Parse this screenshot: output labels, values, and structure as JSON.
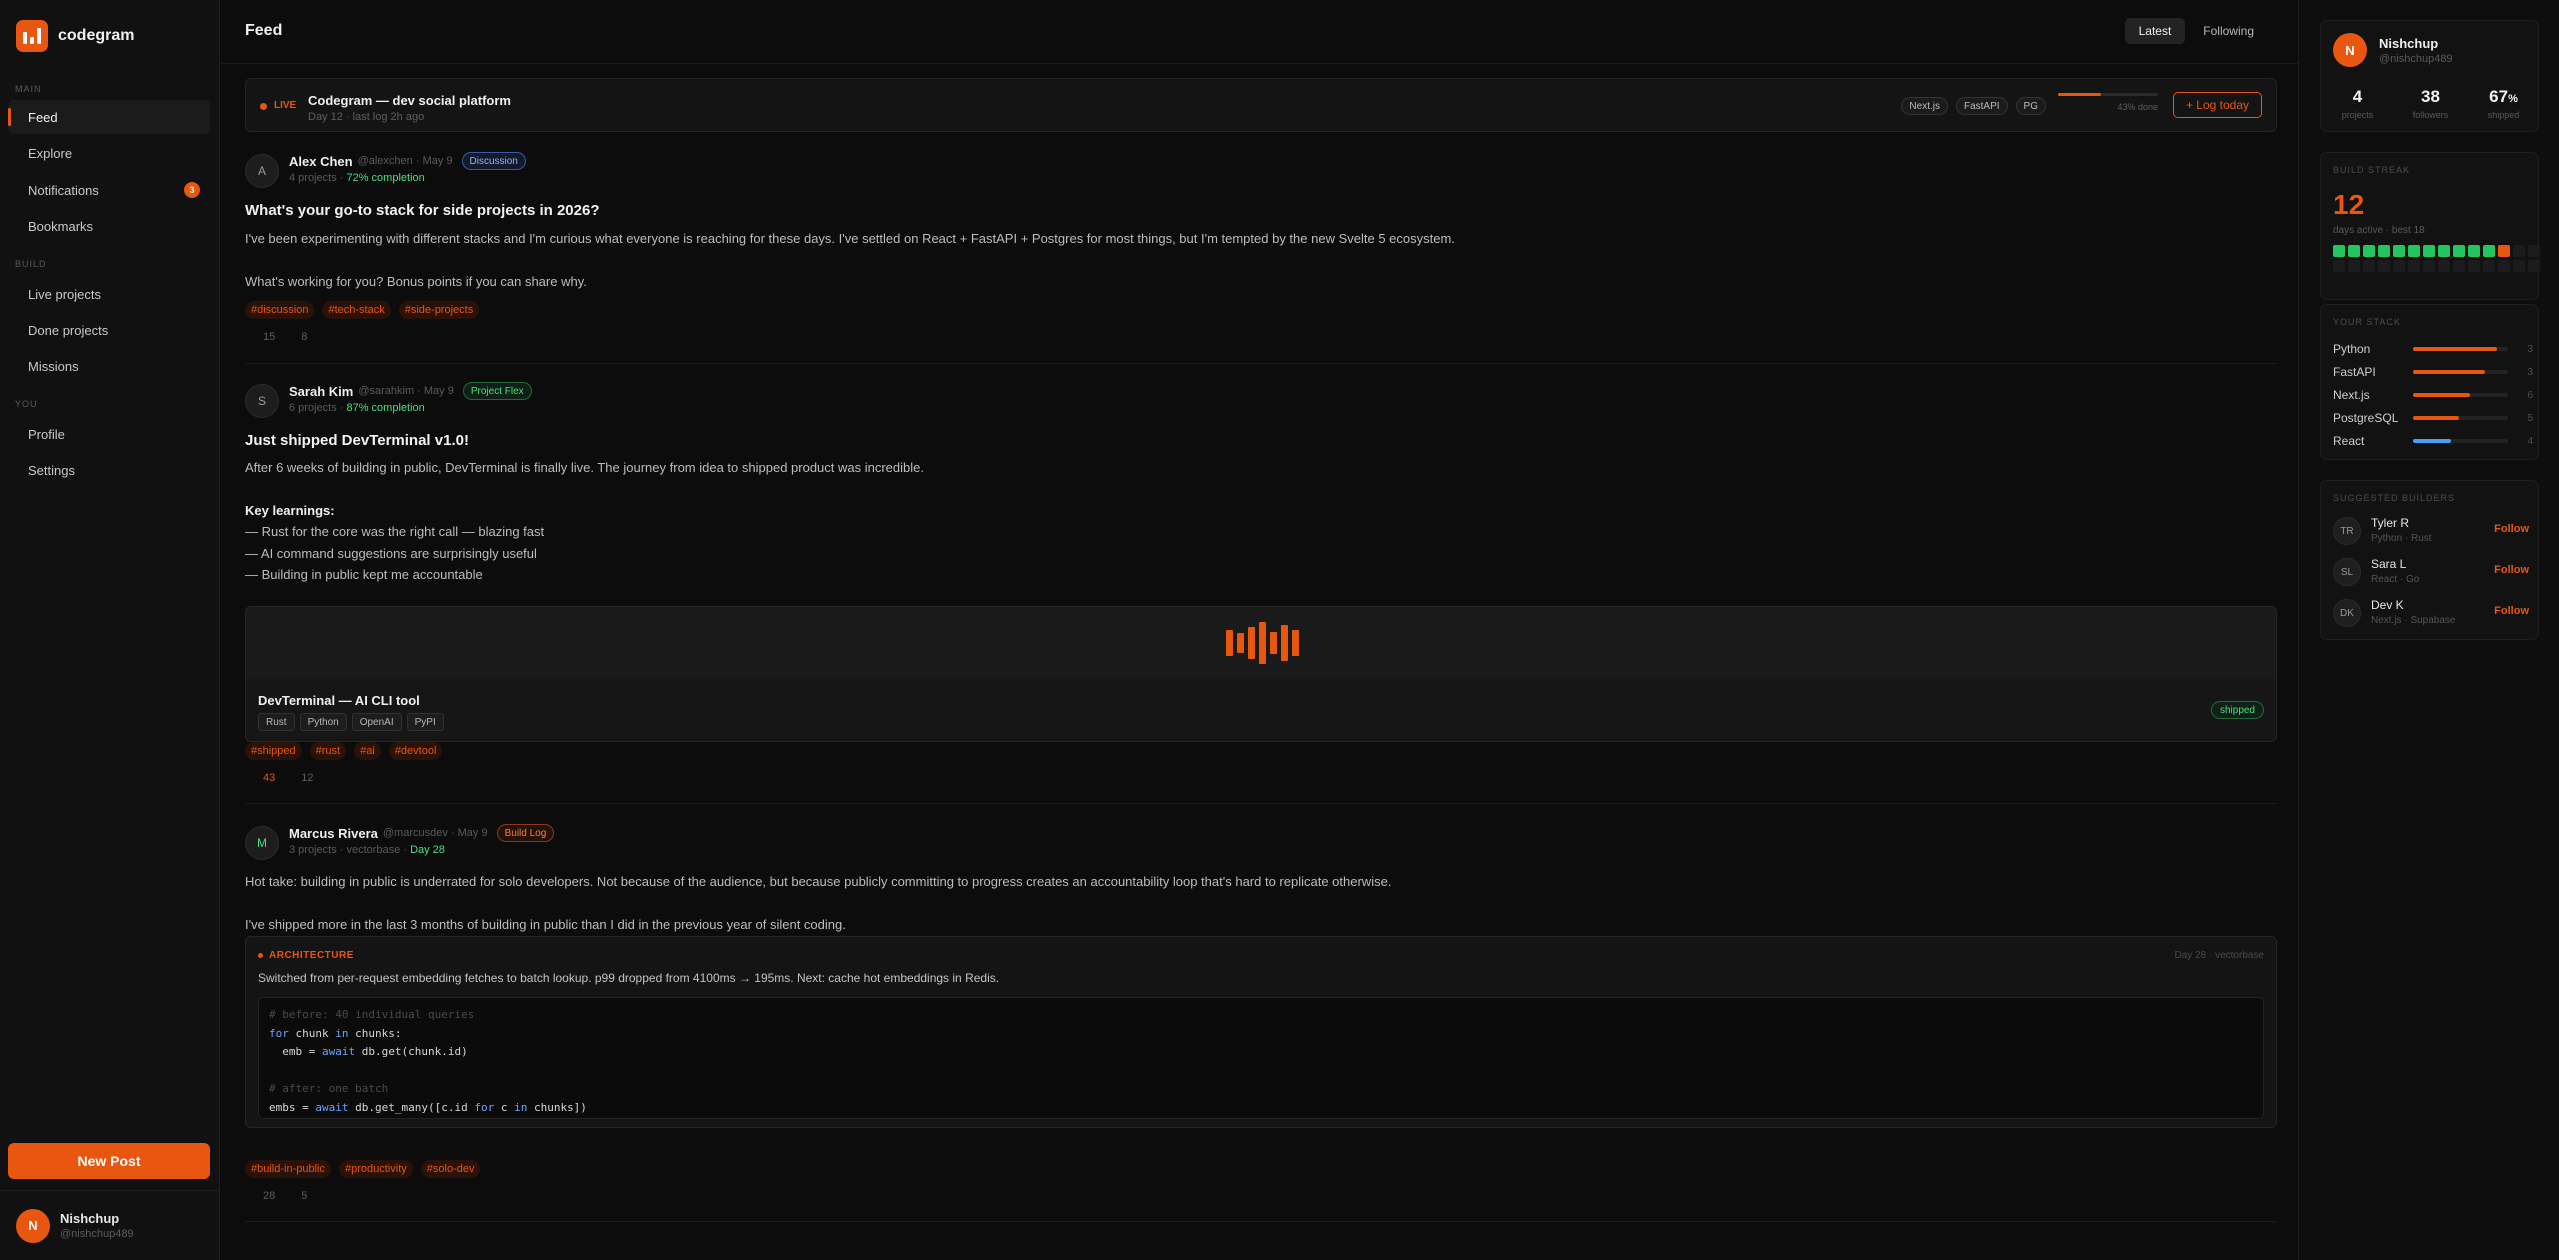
{
  "app": {
    "name": "codegram"
  },
  "sidebar": {
    "sections": {
      "main": "MAIN",
      "build": "BUILD",
      "you": "YOU"
    },
    "items": [
      {
        "label": "Feed"
      },
      {
        "label": "Explore"
      },
      {
        "label": "Notifications",
        "badge": "3"
      },
      {
        "label": "Bookmarks"
      },
      {
        "label": "Live projects"
      },
      {
        "label": "Done projects"
      },
      {
        "label": "Missions"
      },
      {
        "label": "Profile"
      },
      {
        "label": "Settings"
      }
    ],
    "new_post_label": "New Post",
    "user": {
      "initial": "N",
      "name": "Nishchup",
      "handle": "@nishchup489"
    }
  },
  "header": {
    "title": "Feed",
    "tabs": [
      {
        "label": "Latest"
      },
      {
        "label": "Following"
      }
    ]
  },
  "live_banner": {
    "label": "LIVE",
    "title": "Codegram — dev social platform",
    "subtitle": "Day 12 · last log 2h ago",
    "chips": [
      "Next.js",
      "FastAPI",
      "PG"
    ],
    "progress": 43,
    "progress_text": "43% done",
    "button_label": "+ Log today"
  },
  "posts": [
    {
      "initial": "A",
      "author": "Alex Chen",
      "meta": "@alexchen · May 9",
      "badge": "Discussion",
      "sub_prefix": "4 projects ·",
      "sub_highlight": "72% completion",
      "title": "What's your go-to stack for side projects in 2026?",
      "body": [
        "I've been experimenting with different stacks and I'm curious what everyone is reaching for these days. I've settled on React + FastAPI + Postgres for most things, but I'm tempted by the new Svelte 5 ecosystem.",
        "What's working for you? Bonus points if you can share why."
      ],
      "tags": [
        "#discussion",
        "#tech-stack",
        "#side-projects"
      ],
      "likes": "15",
      "comments": "8"
    },
    {
      "initial": "S",
      "author": "Sarah Kim",
      "meta": "@sarahkim · May 9",
      "badge": "Project Flex",
      "sub_prefix": "6 projects ·",
      "sub_highlight": "87% completion",
      "title": "Just shipped DevTerminal v1.0!",
      "body": [
        "After 6 weeks of building in public, DevTerminal is finally live. The journey from idea to shipped product was incredible.",
        "Key learnings:",
        "— Rust for the core was the right call — blazing fast",
        "— AI command suggestions are surprisingly useful",
        "— Building in public kept me accountable"
      ],
      "project": {
        "name": "DevTerminal — AI CLI tool",
        "chips": [
          "Rust",
          "Python",
          "OpenAI",
          "PyPI"
        ],
        "status": "shipped"
      },
      "tags": [
        "#shipped",
        "#rust",
        "#ai",
        "#devtool"
      ],
      "likes": "43",
      "comments": "12"
    },
    {
      "initial": "M",
      "author": "Marcus Rivera",
      "meta": "@marcusdev · May 9",
      "badge": "Build Log",
      "sub_prefix": "3 projects · vectorbase ·",
      "sub_highlight": "Day 28",
      "body": [
        "Hot take: building in public is underrated for solo developers. Not because of the audience, but because publicly committing to progress creates an accountability loop that's hard to replicate otherwise.",
        "I've shipped more in the last 3 months of building in public than I did in the previous year of silent coding."
      ],
      "architecture": {
        "label": "ARCHITECTURE",
        "day": "Day 28 · vectorbase",
        "text": "Switched from per-request embedding fetches to batch lookup. p99 dropped from 4100ms → 195ms. Next: cache hot embeddings in Redis.",
        "code": {
          "c1": "# before: 40 individual queries",
          "l2a": "for",
          "l2b": " chunk ",
          "l2c": "in",
          "l2d": " chunks:",
          "l3a": "  emb = ",
          "l3b": "await",
          "l3c": " db.get(chunk.id)",
          "c2": "# after: one batch",
          "l5a": "embs = ",
          "l5b": "await",
          "l5c": " db.get_many([c.id ",
          "l5d": "for",
          "l5e": " c ",
          "l5f": "in",
          "l5g": " chunks])"
        }
      },
      "tags": [
        "#build-in-public",
        "#productivity",
        "#solo-dev"
      ],
      "likes": "28",
      "comments": "5"
    }
  ],
  "right": {
    "profile": {
      "initial": "N",
      "name": "Nishchup",
      "handle": "@nishchup489",
      "stats": [
        {
          "value": "4",
          "label": "projects"
        },
        {
          "value": "38",
          "label": "followers"
        },
        {
          "value": "67",
          "unit": "%",
          "label": "shipped"
        }
      ]
    },
    "streak": {
      "label": "BUILD STREAK",
      "value": "12",
      "sub": "days active · best 18",
      "active_days": 12,
      "total_cells": 28
    },
    "stack": {
      "label": "YOUR STACK",
      "items": [
        {
          "name": "Python",
          "count": "3",
          "fraction": 0.88,
          "color": "#e8560f"
        },
        {
          "name": "FastAPI",
          "count": "3",
          "fraction": 0.76,
          "color": "#e8560f"
        },
        {
          "name": "Next.js",
          "count": "6",
          "fraction": 0.6,
          "color": "#e8560f"
        },
        {
          "name": "PostgreSQL",
          "count": "5",
          "fraction": 0.48,
          "color": "#e8560f"
        },
        {
          "name": "React",
          "count": "4",
          "fraction": 0.4,
          "color": "#4a9eff"
        }
      ]
    },
    "suggested": {
      "label": "SUGGESTED BUILDERS",
      "follow_label": "Follow",
      "items": [
        {
          "initials": "TR",
          "name": "Tyler R",
          "stack": "Python · Rust"
        },
        {
          "initials": "SL",
          "name": "Sara L",
          "stack": "React · Go"
        },
        {
          "initials": "DK",
          "name": "Dev K",
          "stack": "Next.js · Supabase"
        }
      ]
    }
  }
}
